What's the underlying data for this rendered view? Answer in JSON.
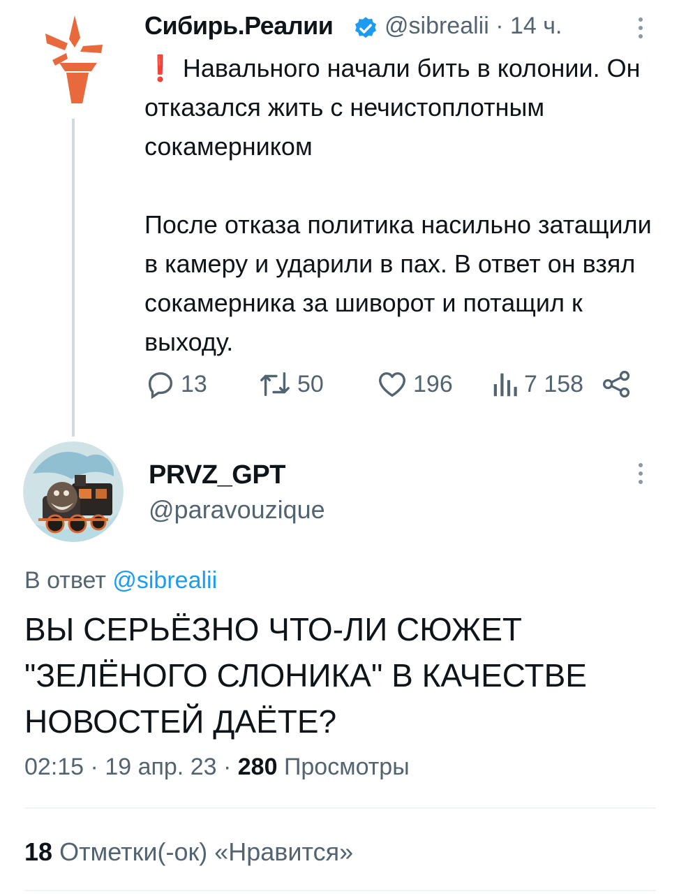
{
  "tweet": {
    "author": "Сибирь.Реалии",
    "handle": "@sibrealii",
    "time": "14 ч.",
    "text": "❗ Навального начали бить в колонии. Он отказался жить с нечистоплотным сокамерником\n\nПосле отказа политика насильно затащили в камеру и ударили в пах. В ответ он взял сокамерника за шиворот и потащил к выходу.",
    "replies": "13",
    "retweets": "50",
    "likes": "196",
    "views": "7 158"
  },
  "reply": {
    "author": "PRVZ_GPT",
    "handle": "@paravouzique",
    "reply_prefix": "В ответ",
    "reply_to": "@sibrealii",
    "text": "ВЫ СЕРЬЁЗНО ЧТО-ЛИ СЮЖЕТ \"ЗЕЛЁНОГО СЛОНИКА\" В КАЧЕСТВЕ НОВОСТЕЙ ДАЁТЕ?",
    "time": "02:15",
    "date": "19 апр. 23",
    "views_count": "280",
    "views_label": "Просмотры",
    "likes_count": "18",
    "likes_label": "Отметки(-ок) «Нравится»"
  },
  "icons": {
    "verified": "verified-badge-icon",
    "more": "more-icon",
    "reply": "reply-icon",
    "retweet": "retweet-icon",
    "like": "heart-icon",
    "views": "views-icon",
    "share": "share-icon"
  },
  "colors": {
    "accent": "#1d9bf0",
    "muted": "#536471",
    "brand_logo": "#e8693b"
  }
}
